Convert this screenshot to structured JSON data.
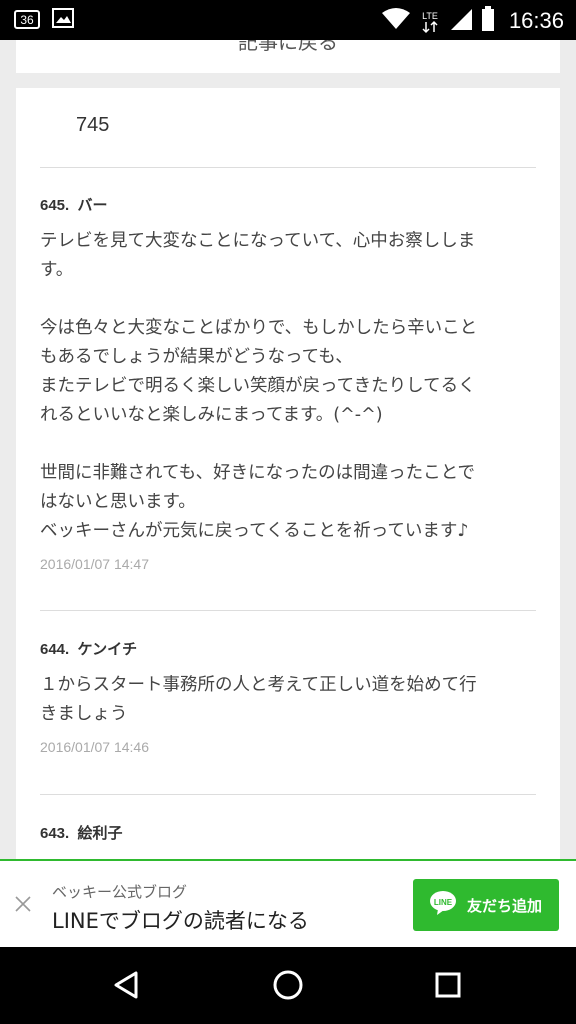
{
  "status_bar": {
    "notification_badge": "36",
    "network": "LTE",
    "time": "16:36"
  },
  "top_card": {
    "back_link": "記事に戻る"
  },
  "comments_section": {
    "count": "745",
    "comments": [
      {
        "number": "645.",
        "author": "バー",
        "body": "テレビを見て大変なことになっていて、心中お察ししま\nす。\n\n今は色々と大変なことばかりで、もしかしたら辛いこと\nもあるでしょうが結果がどうなっても、\nまたテレビで明るく楽しい笑顔が戻ってきたりしてるく\nれるといいなと楽しみにまってます。(^-^)\n\n世間に非難されても、好きになったのは間違ったことで\nはないと思います。\nベッキーさんが元気に戻ってくることを祈っています♪",
        "date": "2016/01/07 14:47"
      },
      {
        "number": "644.",
        "author": "ケンイチ",
        "body": "１からスタート事務所の人と考えて正しい道を始めて行\nきましょう",
        "date": "2016/01/07 14:46"
      },
      {
        "number": "643.",
        "author": "絵利子",
        "body": "",
        "date": ""
      }
    ]
  },
  "line_banner": {
    "subtitle": "ベッキー公式ブログ",
    "title": "LINEでブログの読者になる",
    "button_label": "友だち追加",
    "accent_color": "#2fba2f"
  },
  "icons": [
    "notification-badge-icon",
    "image-icon",
    "wifi-icon",
    "signal-icon",
    "battery-icon",
    "close-icon",
    "line-logo-icon",
    "back-icon",
    "home-icon",
    "recents-icon"
  ]
}
